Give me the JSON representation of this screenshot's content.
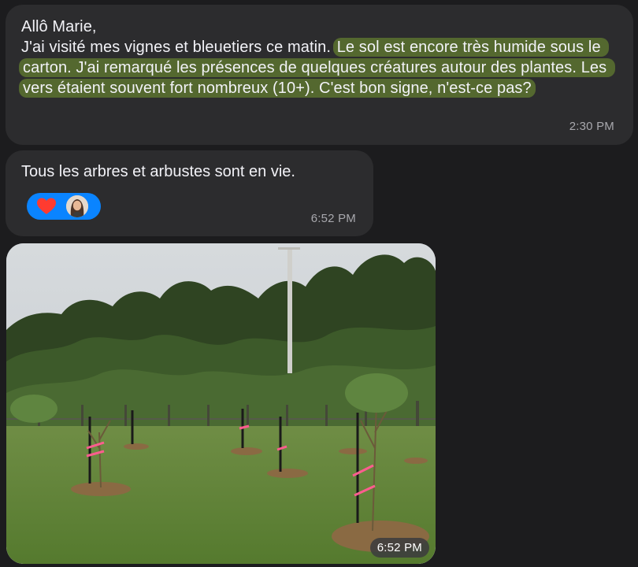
{
  "messages": [
    {
      "greeting": "Allô Marie,",
      "intro": "J'ai visité mes vignes et bleuetiers ce matin. ",
      "highlighted": "Le sol est encore très humide sous le carton. J'ai remarqué les présences de quelques créatures autour des plantes. Les vers étaient souvent fort nombreux (10+). C'est bon signe, n'est-ce pas?",
      "time": "2:30 PM"
    },
    {
      "text": "Tous les arbres et arbustes sont en vie.",
      "time": "6:52 PM",
      "reaction": {
        "icon": "heart-icon",
        "color": "#ff3b30"
      }
    },
    {
      "type": "photo",
      "time": "6:52 PM"
    }
  ],
  "colors": {
    "background": "#1c1c1e",
    "bubble": "#2c2c2e",
    "highlight": "#5f7a30",
    "reaction_pill": "#0a84ff"
  }
}
